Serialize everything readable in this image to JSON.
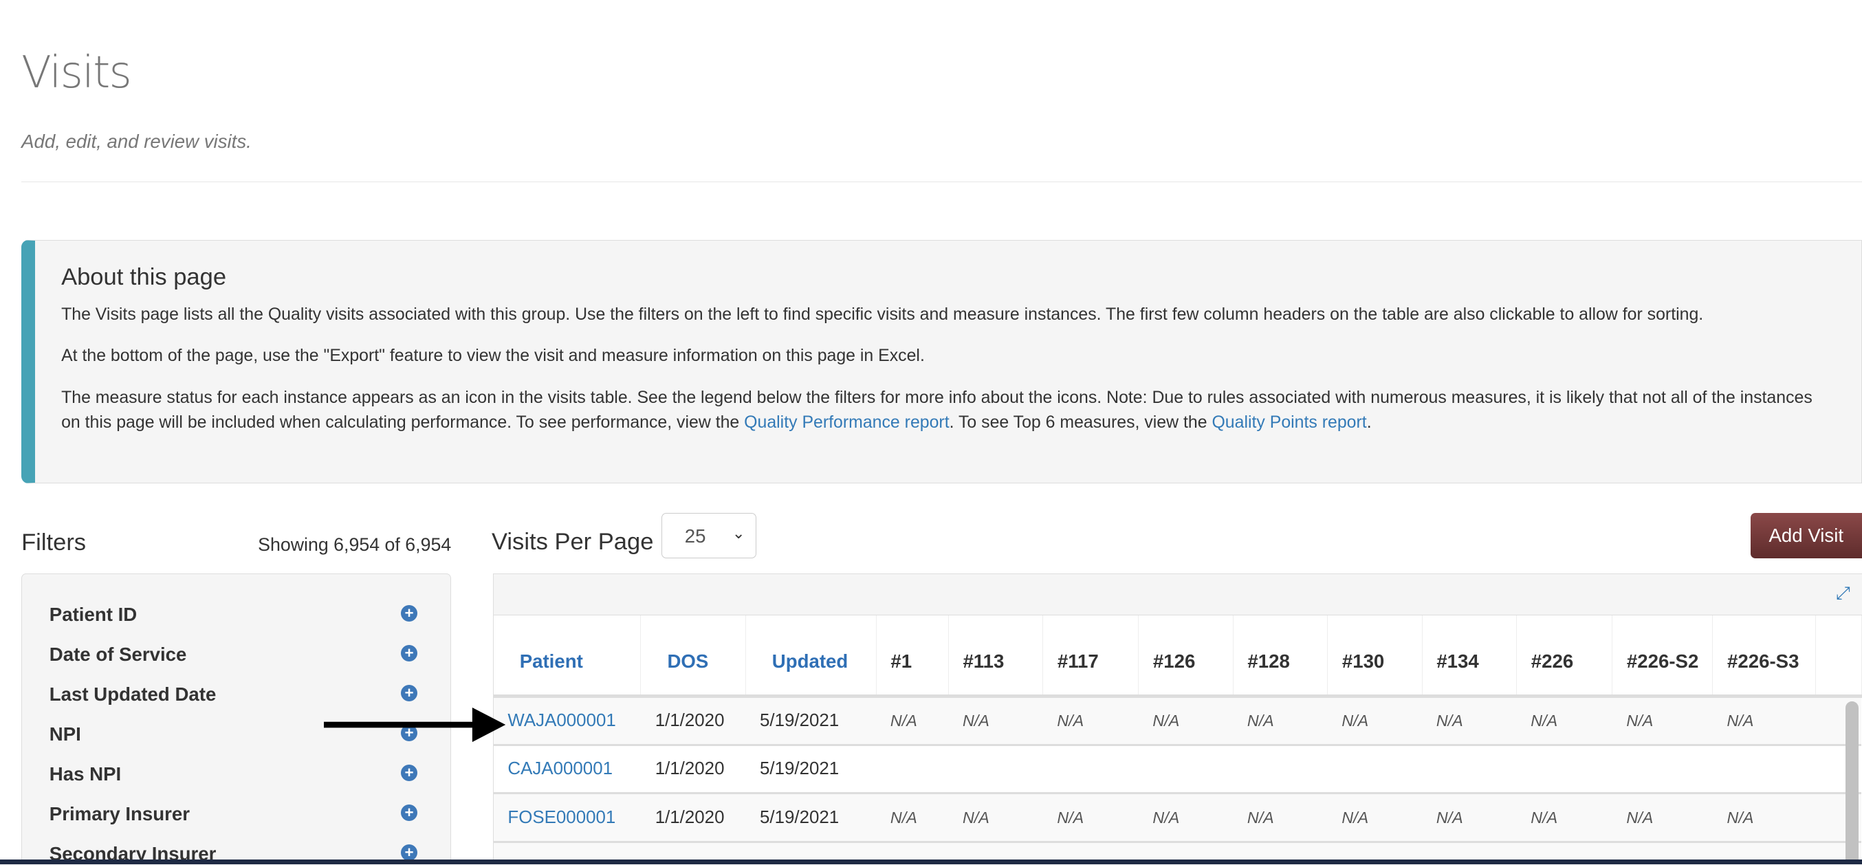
{
  "page": {
    "title": "Visits",
    "subtitle": "Add, edit, and review visits."
  },
  "about": {
    "heading": "About this page",
    "p1": "The Visits page lists all the Quality visits associated with this group. Use the filters on the left to find specific visits and measure instances. The first few column headers on the table are also clickable to allow for sorting.",
    "p2": "At the bottom of the page, use the \"Export\" feature to view the visit and measure information on this page in Excel.",
    "p3a": "The measure status for each instance appears as an icon in the visits table. See the legend below the filters for more info about the icons. Note: Due to rules associated with numerous measures, it is likely that not all of the instances on this page will be included when calculating performance. To see performance, view the ",
    "link1": "Quality Performance report",
    "p3b": ". To see Top 6 measures, view the ",
    "link2": "Quality Points report",
    "p3c": ".",
    "accent_color": "#46a3b6"
  },
  "filters": {
    "title": "Filters",
    "showing": "Showing 6,954 of 6,954",
    "items": [
      {
        "label": "Patient ID",
        "icon": "plus-circle-icon"
      },
      {
        "label": "Date of Service",
        "icon": "plus-circle-icon"
      },
      {
        "label": "Last Updated Date",
        "icon": "plus-circle-icon"
      },
      {
        "label": "NPI",
        "icon": "plus-circle-icon"
      },
      {
        "label": "Has NPI",
        "icon": "plus-circle-icon"
      },
      {
        "label": "Primary Insurer",
        "icon": "plus-circle-icon"
      },
      {
        "label": "Secondary Insurer",
        "icon": "plus-circle-icon"
      }
    ]
  },
  "toolbar": {
    "visits_per_page_label": "Visits Per Page",
    "visits_per_page_value": "25",
    "add_visit_label": "Add Visit",
    "add_visit_color": "#6b3535"
  },
  "table": {
    "columns": [
      "Patient",
      "DOS",
      "Updated",
      "#1",
      "#113",
      "#117",
      "#126",
      "#128",
      "#130",
      "#134",
      "#226",
      "#226-S2",
      "#226-S3"
    ],
    "rows": [
      {
        "patient": "WAJA000001",
        "dos": "1/1/2020",
        "updated": "5/19/2021",
        "measures": [
          "N/A",
          "N/A",
          "N/A",
          "N/A",
          "N/A",
          "N/A",
          "N/A",
          "N/A",
          "N/A",
          "N/A"
        ]
      },
      {
        "patient": "CAJA000001",
        "dos": "1/1/2020",
        "updated": "5/19/2021",
        "measures": [
          "",
          "",
          "",
          "",
          "",
          "",
          "",
          "",
          "",
          ""
        ]
      },
      {
        "patient": "FOSE000001",
        "dos": "1/1/2020",
        "updated": "5/19/2021",
        "measures": [
          "N/A",
          "N/A",
          "N/A",
          "N/A",
          "N/A",
          "N/A",
          "N/A",
          "N/A",
          "N/A",
          "N/A"
        ]
      }
    ]
  },
  "annotation": {
    "icon": "arrow-right-icon"
  }
}
